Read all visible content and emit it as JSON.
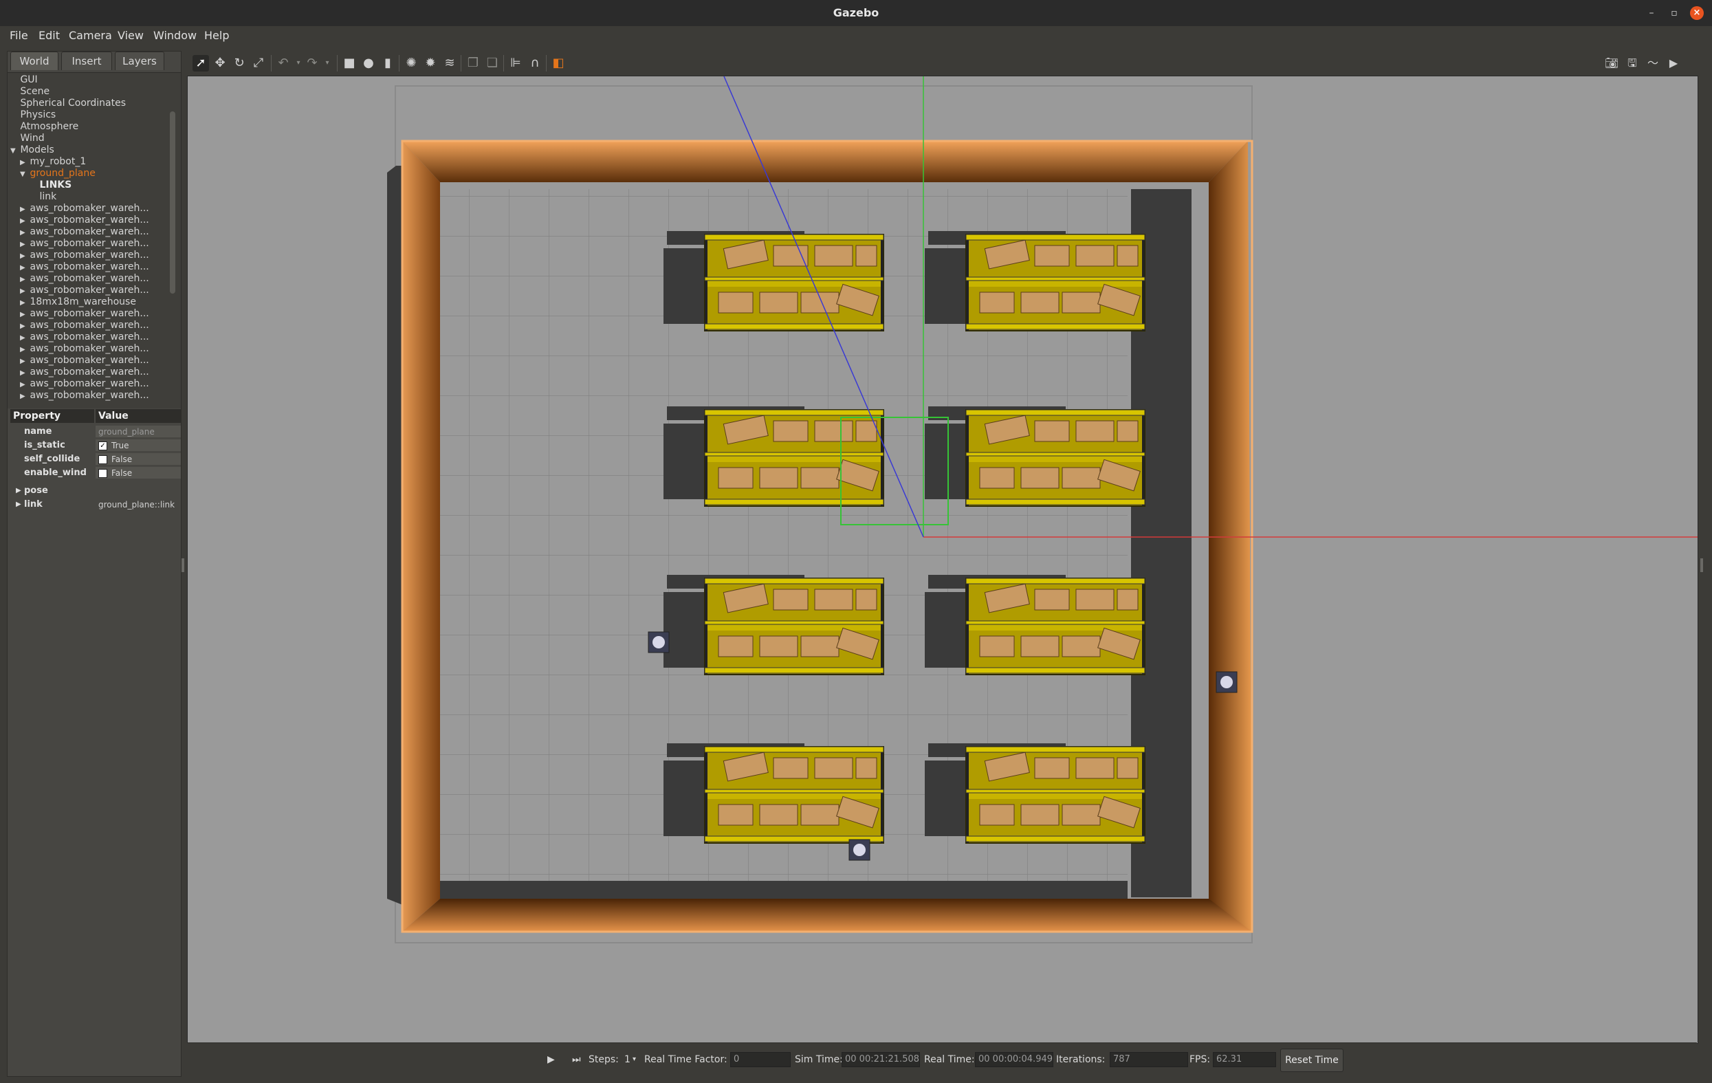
{
  "window": {
    "title": "Gazebo",
    "controls": {
      "minimize": "–",
      "maximize": "▫",
      "close": "×"
    }
  },
  "menu": [
    "File",
    "Edit",
    "Camera",
    "View",
    "Window",
    "Help"
  ],
  "tabs": [
    "World",
    "Insert",
    "Layers"
  ],
  "tree": [
    {
      "label": "GUI",
      "indent": 0
    },
    {
      "label": "Scene",
      "indent": 0
    },
    {
      "label": "Spherical Coordinates",
      "indent": 0
    },
    {
      "label": "Physics",
      "indent": 0
    },
    {
      "label": "Atmosphere",
      "indent": 0
    },
    {
      "label": "Wind",
      "indent": 0
    },
    {
      "label": "Models",
      "indent": 0,
      "arrow": "▼"
    },
    {
      "label": "my_robot_1",
      "indent": 1,
      "arrow": "▶"
    },
    {
      "label": "ground_plane",
      "indent": 1,
      "arrow": "▼",
      "selected": true
    },
    {
      "label": "LINKS",
      "indent": 2,
      "bold": true
    },
    {
      "label": "link",
      "indent": 2
    },
    {
      "label": "aws_robomaker_wareh...",
      "indent": 1,
      "arrow": "▶"
    },
    {
      "label": "aws_robomaker_wareh...",
      "indent": 1,
      "arrow": "▶"
    },
    {
      "label": "aws_robomaker_wareh...",
      "indent": 1,
      "arrow": "▶"
    },
    {
      "label": "aws_robomaker_wareh...",
      "indent": 1,
      "arrow": "▶"
    },
    {
      "label": "aws_robomaker_wareh...",
      "indent": 1,
      "arrow": "▶"
    },
    {
      "label": "aws_robomaker_wareh...",
      "indent": 1,
      "arrow": "▶"
    },
    {
      "label": "aws_robomaker_wareh...",
      "indent": 1,
      "arrow": "▶"
    },
    {
      "label": "aws_robomaker_wareh...",
      "indent": 1,
      "arrow": "▶"
    },
    {
      "label": "18mx18m_warehouse",
      "indent": 1,
      "arrow": "▶"
    },
    {
      "label": "aws_robomaker_wareh...",
      "indent": 1,
      "arrow": "▶"
    },
    {
      "label": "aws_robomaker_wareh...",
      "indent": 1,
      "arrow": "▶"
    },
    {
      "label": "aws_robomaker_wareh...",
      "indent": 1,
      "arrow": "▶"
    },
    {
      "label": "aws_robomaker_wareh...",
      "indent": 1,
      "arrow": "▶"
    },
    {
      "label": "aws_robomaker_wareh...",
      "indent": 1,
      "arrow": "▶"
    },
    {
      "label": "aws_robomaker_wareh...",
      "indent": 1,
      "arrow": "▶"
    },
    {
      "label": "aws_robomaker_wareh...",
      "indent": 1,
      "arrow": "▶"
    },
    {
      "label": "aws_robomaker_wareh...",
      "indent": 1,
      "arrow": "▶"
    }
  ],
  "properties": {
    "header_property": "Property",
    "header_value": "Value",
    "rows": [
      {
        "key": "name",
        "value": "ground_plane",
        "dim": true
      },
      {
        "key": "is_static",
        "value": "True",
        "checkbox": true,
        "checked": true
      },
      {
        "key": "self_collide",
        "value": "False",
        "checkbox": true,
        "checked": false
      },
      {
        "key": "enable_wind",
        "value": "False",
        "checkbox": true,
        "checked": false
      },
      {
        "key": "pose",
        "value": "",
        "expandable": true
      },
      {
        "key": "link",
        "value": "ground_plane::link",
        "expandable": true
      }
    ]
  },
  "toolbar": {
    "left_tools": [
      "select-icon",
      "translate-icon",
      "rotate-icon",
      "scale-icon",
      "undo-icon",
      "undo-dropdown-icon",
      "redo-icon",
      "redo-dropdown-icon",
      "box-icon",
      "sphere-icon",
      "cylinder-icon",
      "point-light-icon",
      "spot-light-icon",
      "directional-light-icon",
      "copy-icon",
      "paste-icon",
      "align-icon",
      "snap-icon",
      "change-view-icon"
    ],
    "right_tools": [
      "screenshot-icon",
      "log-icon",
      "plot-icon",
      "video-icon"
    ]
  },
  "colors": {
    "accent": "#e4751b",
    "floor": "#9a9a9a",
    "wall_orange": "#d9843a",
    "shelf_yellow": "#c9b400",
    "box_brown": "#c99a63",
    "x_axis": "#d33a3a",
    "y_axis": "#36c336",
    "z_axis": "#3a3ad3"
  },
  "status": {
    "steps_label": "Steps:",
    "steps_value": "1",
    "rtf_label": "Real Time Factor:",
    "rtf_value": "0",
    "sim_time_label": "Sim Time:",
    "sim_time_value": "00 00:21:21.508",
    "real_time_label": "Real Time:",
    "real_time_value": "00 00:00:04.949",
    "iterations_label": "Iterations:",
    "iterations_value": "787",
    "fps_label": "FPS:",
    "fps_value": "62.31",
    "reset_label": "Reset Time"
  }
}
